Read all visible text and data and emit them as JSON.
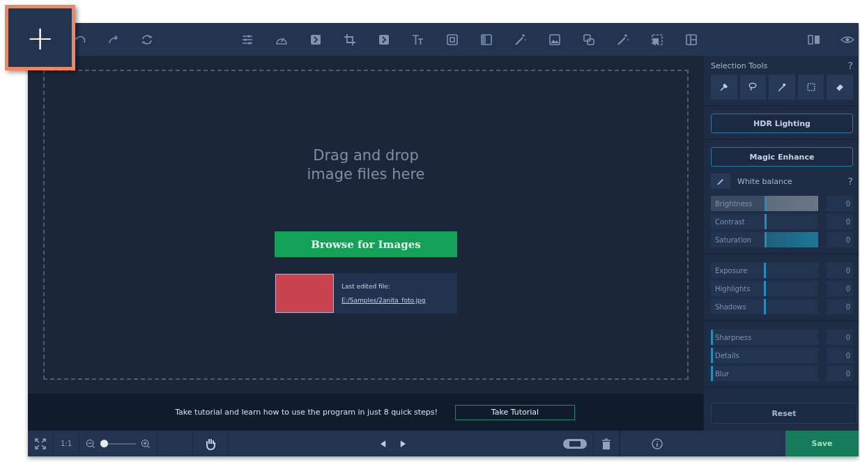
{
  "add_button": {
    "label": "+"
  },
  "selection_tools": {
    "title": "Selection Tools",
    "help": "?"
  },
  "drop_zone": {
    "message": "Drag and drop\nimage files here",
    "browse_button": "Browse for Images",
    "last_file_label": "Last edited file:",
    "last_file_path": "E:/Samples/2anita_foto.jpg"
  },
  "effects": {
    "hdr_button": "HDR Lighting",
    "magic_button": "Magic Enhance",
    "white_balance": "White balance",
    "help": "?"
  },
  "slider_groups": [
    [
      {
        "name": "Brightness",
        "kind": "brightness",
        "level": 0.5,
        "value": "0"
      },
      {
        "name": "Contrast",
        "kind": "plain",
        "level": 0.5,
        "value": "0"
      },
      {
        "name": "Saturation",
        "kind": "saturation",
        "level": 0.5,
        "value": "0"
      }
    ],
    [
      {
        "name": "Exposure",
        "kind": "plain",
        "level": 0.5,
        "value": "0"
      },
      {
        "name": "Highlights",
        "kind": "plain",
        "level": 0.5,
        "value": "0"
      },
      {
        "name": "Shadows",
        "kind": "plain",
        "level": 0.5,
        "value": "0"
      }
    ],
    [
      {
        "name": "Sharpness",
        "kind": "plain",
        "level": 0,
        "value": "0"
      },
      {
        "name": "Details",
        "kind": "plain",
        "level": 0,
        "value": "0"
      },
      {
        "name": "Blur",
        "kind": "plain",
        "level": 0,
        "value": "0"
      }
    ]
  ],
  "reset_button": "Reset",
  "tutorial": {
    "message": "Take tutorial and learn how to use the program in just 8 quick steps!",
    "button": "Take Tutorial"
  },
  "bottom_bar": {
    "ratio_button": "1:1",
    "zoom": {
      "level": 0.1
    },
    "save_button": "Save"
  }
}
